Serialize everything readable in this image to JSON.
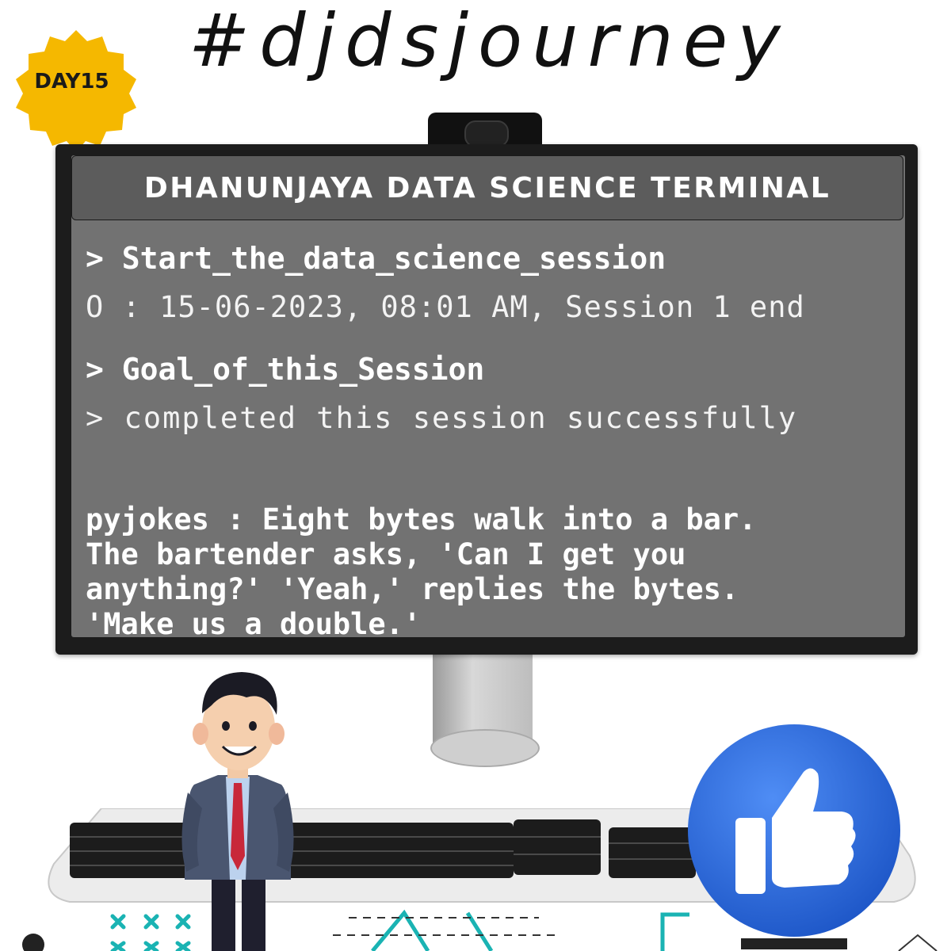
{
  "hashtag": "#djdsjourney",
  "badge": {
    "label": "DAY15",
    "color": "#f5b800"
  },
  "terminal": {
    "title": "DHANUNJAYA DATA SCIENCE TERMINAL",
    "command_1": "> Start_the_data_science_session",
    "output_1": "O : 15-06-2023, 08:01 AM, Session 1 end",
    "command_2": "> Goal_of_this_Session",
    "output_2": "> completed this session successfully",
    "joke": "pyjokes : Eight bytes walk into a bar.\nThe bartender asks, 'Can I get you\nanything?' 'Yeah,' replies the bytes.\n'Make us a double.'"
  },
  "icons": {
    "like": "thumbs-up-icon",
    "webcam": "webcam-icon",
    "character": "businessman-illustration"
  },
  "colors": {
    "screen": "#727272",
    "header": "#5c5c5c",
    "like_blue": "#2f6fe0",
    "accent_teal": "#1ab3b3"
  }
}
